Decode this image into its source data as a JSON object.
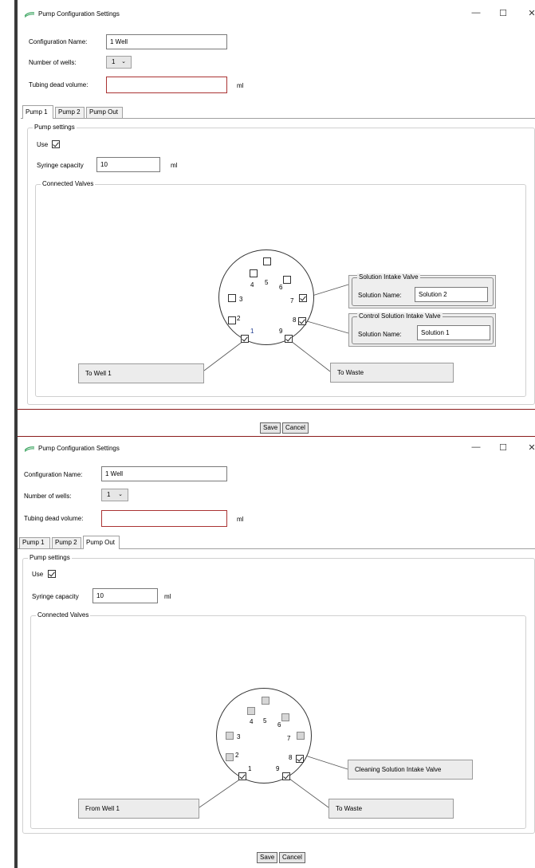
{
  "window1": {
    "title": "Pump Configuration Settings",
    "controls": {
      "minimize": "—",
      "maximize": "☐",
      "close": "✕"
    },
    "config_name_label": "Configuration Name:",
    "config_name_value": "1 Well",
    "wells_label": "Number of wells:",
    "wells_value": "1",
    "tubing_label": "Tubing dead volume:",
    "tubing_value": "",
    "tubing_unit": "ml",
    "tabs": [
      "Pump 1",
      "Pump 2",
      "Pump Out"
    ],
    "active_tab": "Pump 1",
    "pump_settings_label": "Pump settings",
    "use_label": "Use",
    "syringe_label": "Syringe capacity",
    "syringe_value": "10",
    "syringe_unit": "ml",
    "connected_valves_label": "Connected Valves",
    "ports": {
      "p1": "1",
      "p2": "2",
      "p3": "3",
      "p4": "4",
      "p5": "5",
      "p6": "6",
      "p7": "7",
      "p8": "8",
      "p9": "9"
    },
    "solution_intake": {
      "label": "Solution Intake Valve",
      "name_label": "Solution Name:",
      "name_value": "Solution 2"
    },
    "control_intake": {
      "label": "Control Solution Intake Valve",
      "name_label": "Solution Name:",
      "name_value": "Solution 1"
    },
    "to_well": "To Well 1",
    "to_waste": "To Waste",
    "save": "Save",
    "cancel": "Cancel"
  },
  "window2": {
    "title": "Pump Configuration Settings",
    "controls": {
      "minimize": "—",
      "maximize": "☐",
      "close": "✕"
    },
    "config_name_label": "Configuration Name:",
    "config_name_value": "1 Well",
    "wells_label": "Number of wells:",
    "wells_value": "1",
    "tubing_label": "Tubing dead volume:",
    "tubing_value": "",
    "tubing_unit": "ml",
    "tabs": [
      "Pump 1",
      "Pump 2",
      "Pump Out"
    ],
    "active_tab": "Pump Out",
    "pump_settings_label": "Pump settings",
    "use_label": "Use",
    "syringe_label": "Syringe capacity",
    "syringe_value": "10",
    "syringe_unit": "ml",
    "connected_valves_label": "Connected Valves",
    "ports": {
      "p1": "1",
      "p2": "2",
      "p3": "3",
      "p4": "4",
      "p5": "5",
      "p6": "6",
      "p7": "7",
      "p8": "8",
      "p9": "9"
    },
    "cleaning_intake": "Cleaning Solution Intake Valve",
    "from_well": "From Well 1",
    "to_waste": "To Waste",
    "save": "Save",
    "cancel": "Cancel"
  },
  "colors": {
    "accent_red": "#a33333",
    "icon_green": "#2e9e55",
    "port_blue": "#1f3b8f"
  },
  "icons": [
    "app-icon",
    "minimize-icon",
    "maximize-icon",
    "close-icon",
    "checkmark-icon",
    "chevron-down-icon"
  ]
}
